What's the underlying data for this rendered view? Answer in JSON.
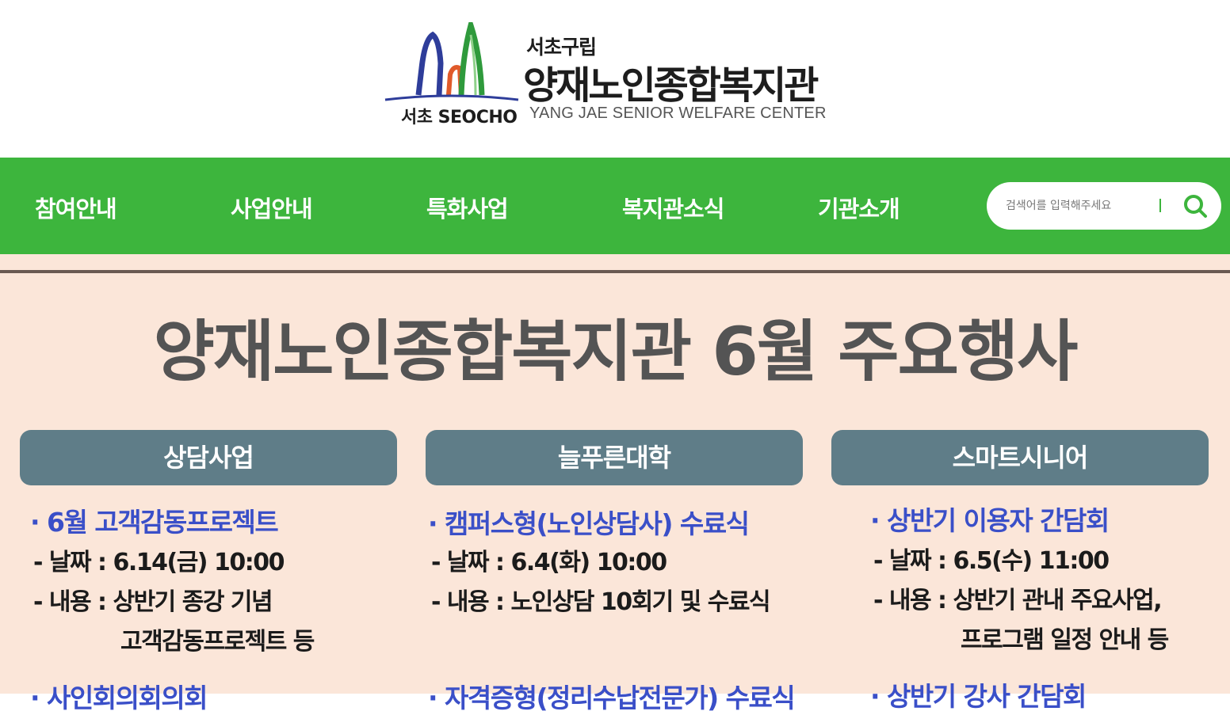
{
  "header": {
    "logo": {
      "mark_label": "서초 SEOCHO",
      "small_title": "서초구립",
      "main_title": "양재노인종합복지관",
      "english_name": "YANG JAE SENIOR WELFARE CENTER"
    }
  },
  "nav": {
    "items": [
      {
        "label": "참여안내"
      },
      {
        "label": "사업안내"
      },
      {
        "label": "특화사업"
      },
      {
        "label": "복지관소식"
      },
      {
        "label": "기관소개"
      }
    ],
    "search": {
      "placeholder": "검색어를 입력해주세요",
      "icon": "search-icon"
    }
  },
  "banner": {
    "title": "양재노인종합복지관 6월 주요행사",
    "columns": [
      {
        "heading": "상담사업",
        "events": [
          {
            "title": "· 6월 고객감동프로젝트",
            "date": "- 날짜 : 6.14(금) 10:00",
            "content": "- 내용 : 상반기 종강 기념",
            "content_cont": "고객감동프로젝트 등"
          },
          {
            "title": "· 사인회의회의회"
          }
        ]
      },
      {
        "heading": "늘푸른대학",
        "events": [
          {
            "title": "· 캠퍼스형(노인상담사) 수료식",
            "date": "- 날짜 : 6.4(화) 10:00",
            "content": "- 내용 : 노인상담 10회기 및 수료식"
          },
          {
            "title": "· 자격증형(정리수납전문가) 수료식"
          }
        ]
      },
      {
        "heading": "스마트시니어",
        "events": [
          {
            "title": "· 상반기 이용자 간담회",
            "date": "- 날짜 : 6.5(수) 11:00",
            "content": "- 내용 : 상반기 관내 주요사업,",
            "content_cont": "프로그램 일정 안내 등"
          },
          {
            "title": "· 상반기 강사 간담회"
          }
        ]
      }
    ]
  },
  "colors": {
    "nav_green": "#3db53d",
    "banner_bg": "#fbe6d9",
    "column_header": "#5f7d88",
    "event_title_blue": "#3a4fc8",
    "banner_title_gray": "#545454"
  }
}
